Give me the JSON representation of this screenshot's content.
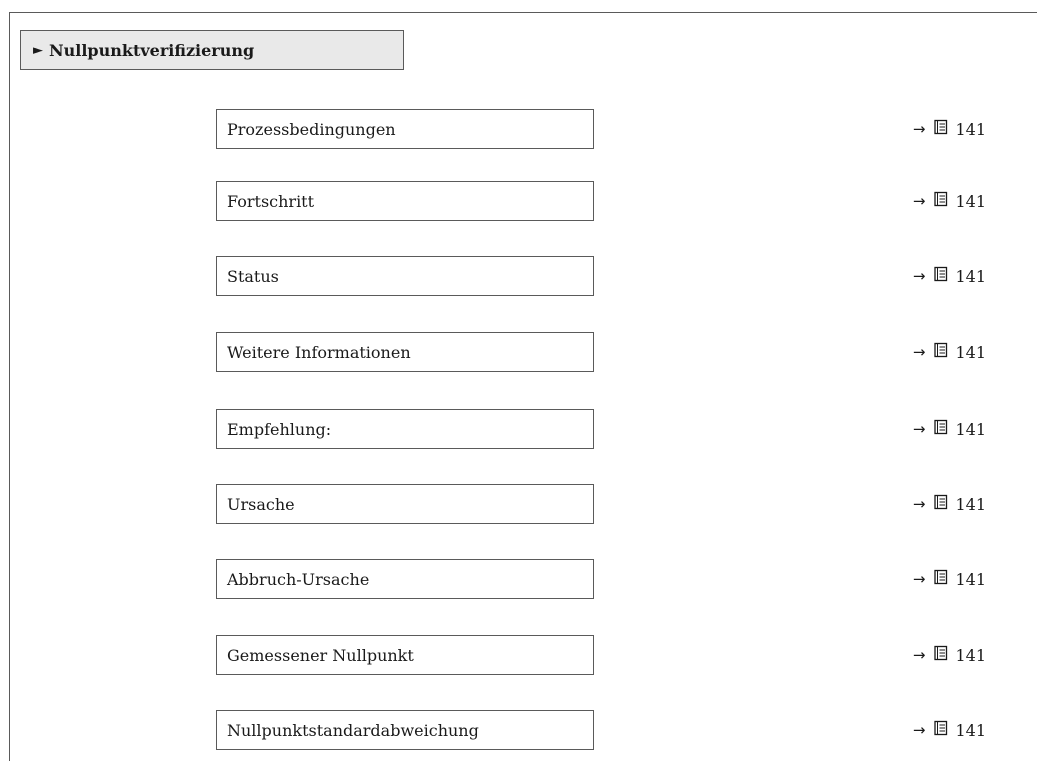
{
  "section": {
    "title": "Nullpunktverifizierung",
    "marker": "►"
  },
  "reference_arrow": "→",
  "reference_icon": "book-icon",
  "parameters": [
    {
      "label": "Prozessbedingungen",
      "page": "141"
    },
    {
      "label": "Fortschritt",
      "page": "141"
    },
    {
      "label": "Status",
      "page": "141"
    },
    {
      "label": "Weitere Informationen",
      "page": "141"
    },
    {
      "label": "Empfehlung:",
      "page": "141"
    },
    {
      "label": "Ursache",
      "page": "141"
    },
    {
      "label": "Abbruch-Ursache",
      "page": "141"
    },
    {
      "label": "Gemessener Nullpunkt",
      "page": "141"
    },
    {
      "label": "Nullpunktstandardabweichung",
      "page": "141"
    }
  ]
}
